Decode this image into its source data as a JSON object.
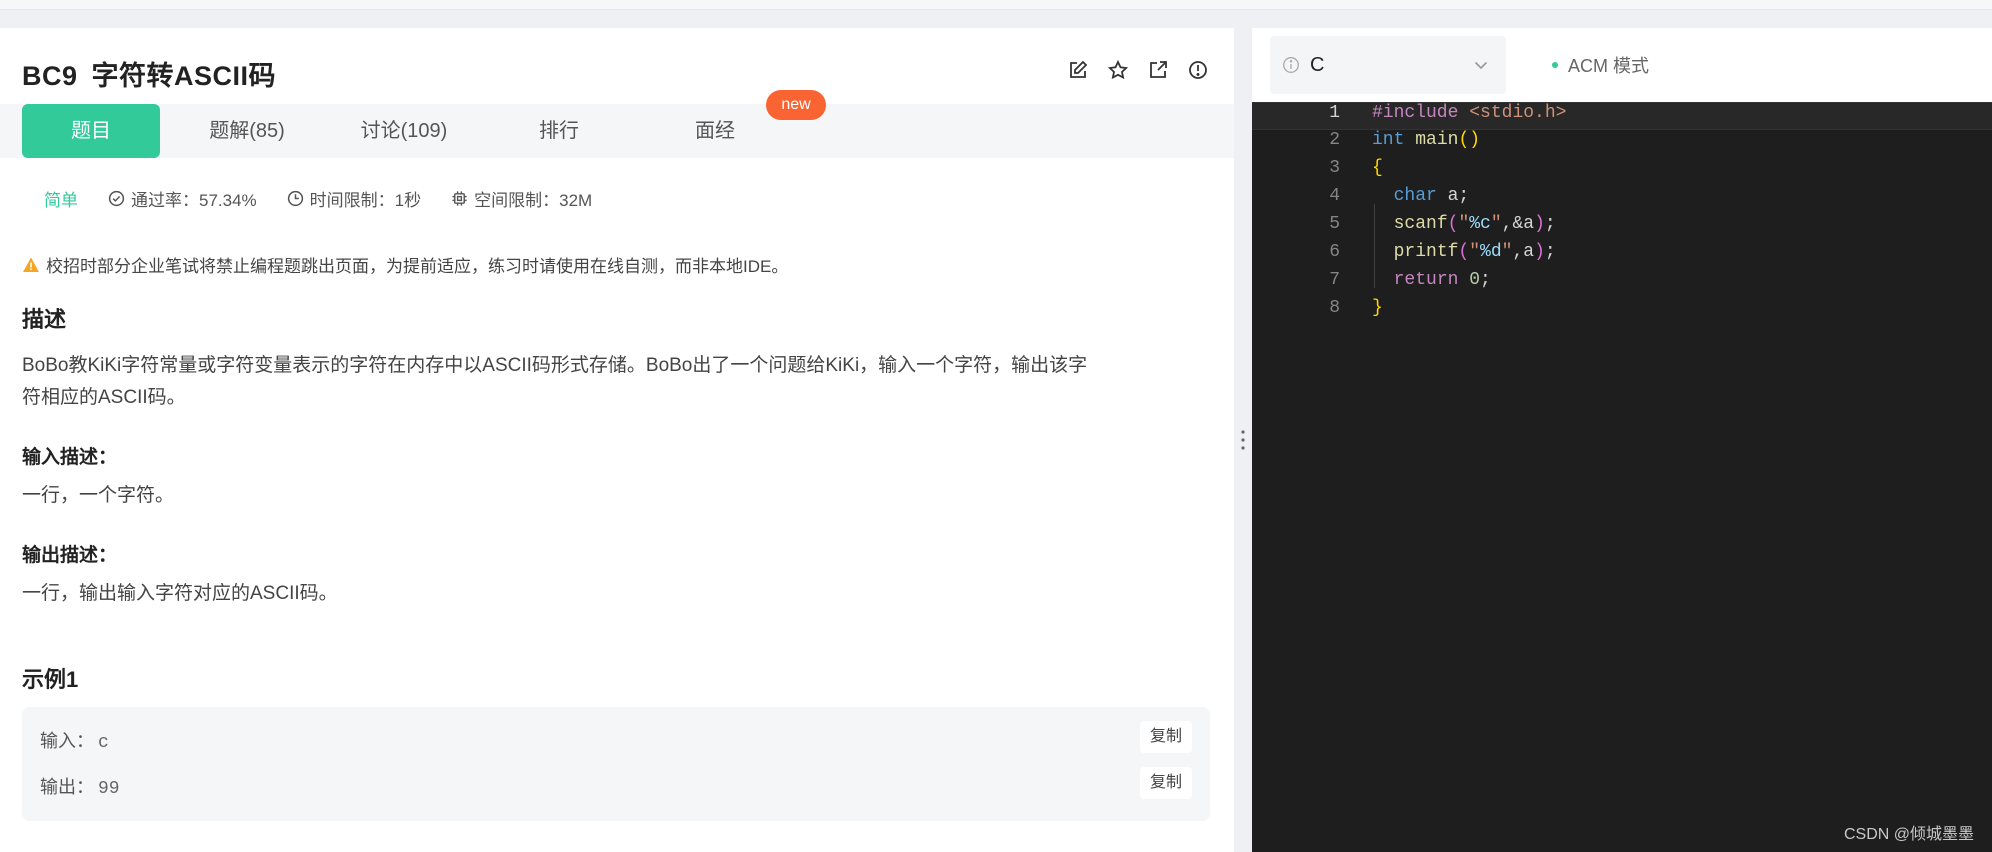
{
  "problem": {
    "code": "BC9",
    "title": "字符转ASCII码"
  },
  "tabs": [
    {
      "label": "题目"
    },
    {
      "label": "题解(85)"
    },
    {
      "label": "讨论(109)"
    },
    {
      "label": "排行"
    },
    {
      "label": "面经"
    }
  ],
  "new_badge": "new",
  "meta": {
    "difficulty": "简单",
    "pass_rate": "通过率：57.34%",
    "time_limit": "时间限制：1秒",
    "space_limit": "空间限制：32M"
  },
  "warning": "校招时部分企业笔试将禁止编程题跳出页面，为提前适应，练习时请使用在线自测，而非本地IDE。",
  "description": {
    "heading": "描述",
    "line1": "BoBo教KiKi字符常量或字符变量表示的字符在内存中以ASCII码形式存储。BoBo出了一个问题给KiKi，输入一个字符，输出该字",
    "line2": "符相应的ASCII码。"
  },
  "input_desc": {
    "heading": "输入描述：",
    "text": "一行，一个字符。"
  },
  "output_desc": {
    "heading": "输出描述：",
    "text": "一行，输出输入字符对应的ASCII码。"
  },
  "example": {
    "heading": "示例1",
    "input_label": "输入：",
    "input_value": "c",
    "output_label": "输出：",
    "output_value": "99",
    "copy_label": "复制"
  },
  "editor": {
    "language": "C",
    "mode": "ACM 模式",
    "line_numbers": [
      "1",
      "2",
      "3",
      "4",
      "5",
      "6",
      "7",
      "8"
    ],
    "code": [
      "#include <stdio.h>",
      "int main()",
      "{",
      "  char a;",
      "  scanf(\"%c\",&a);",
      "  printf(\"%d\",a);",
      "  return 0;",
      "}"
    ]
  },
  "watermark": "CSDN @倾城墨墨",
  "colors": {
    "accent": "#32ca99",
    "badge": "#fa6432",
    "editor_bg": "#1e1e1e"
  },
  "icons": [
    "edit-icon",
    "star-icon",
    "external-link-icon",
    "info-icon",
    "check-circle-icon",
    "clock-icon",
    "chip-icon",
    "warning-icon",
    "chevron-down-icon",
    "drag-handle-icon"
  ]
}
